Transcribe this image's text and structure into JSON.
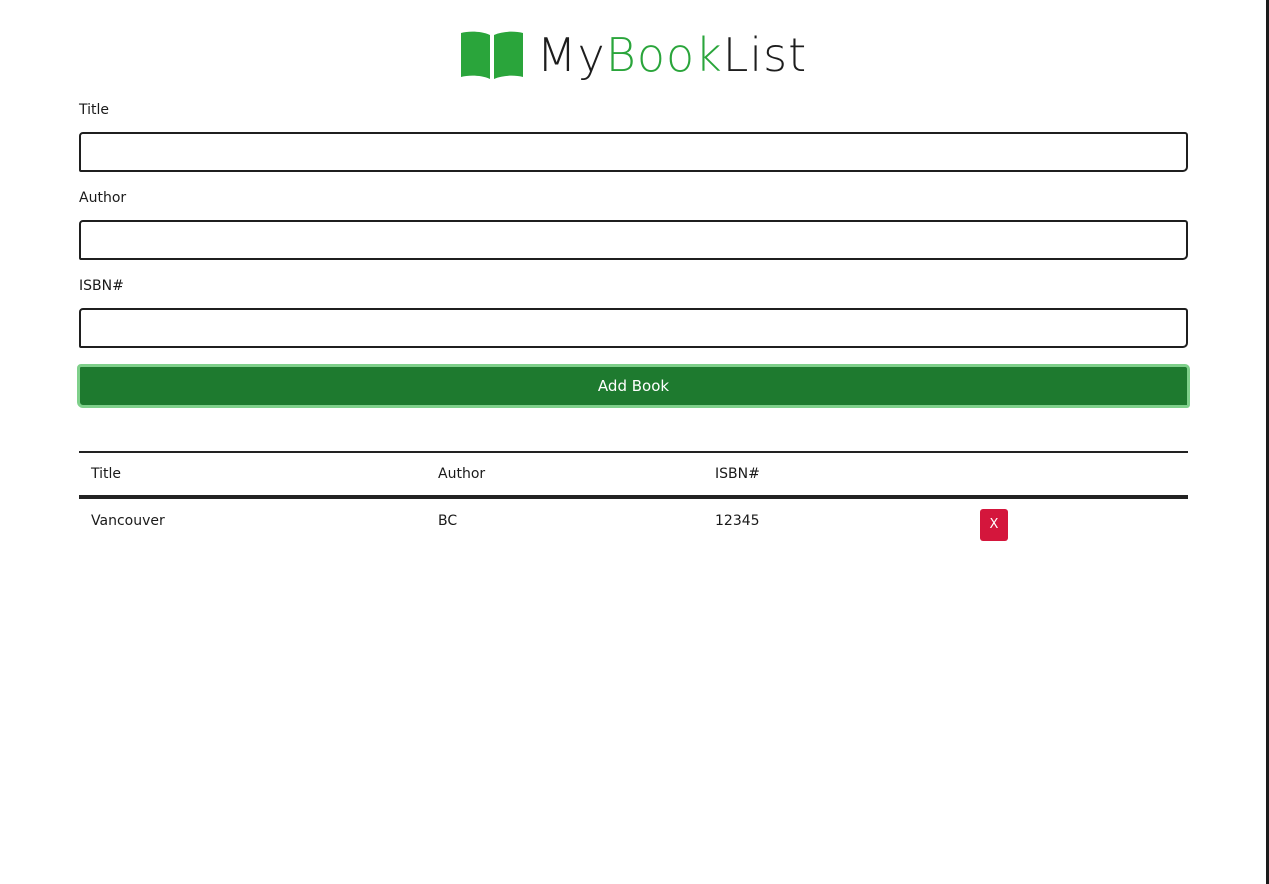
{
  "app": {
    "logo_my": "My",
    "logo_book": "Book",
    "logo_list": "List",
    "logo_icon": "open-book-icon",
    "brand_green": "#2aa53b"
  },
  "form": {
    "title_label": "Title",
    "title_value": "",
    "author_label": "Author",
    "author_value": "",
    "isbn_label": "ISBN#",
    "isbn_value": "",
    "submit_label": "Add Book",
    "submit_color": "#1e7a2f"
  },
  "table": {
    "headers": [
      "Title",
      "Author",
      "ISBN#",
      ""
    ],
    "rows": [
      {
        "title": "Vancouver",
        "author": "BC",
        "isbn": "12345",
        "delete_label": "X"
      }
    ],
    "delete_color": "#d4163c"
  }
}
